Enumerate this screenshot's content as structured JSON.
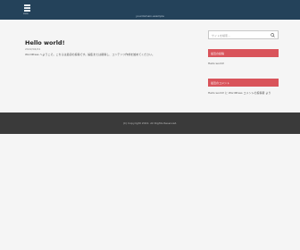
{
  "header": {
    "menu_label": "MENU",
    "site_url": "yourdomain.example"
  },
  "post": {
    "title": "Hello world!",
    "date": "2022/04/01",
    "excerpt": "WordPress へようこそ。こちらは最初の投稿です。編集または削除し、コンテンツ作成を始めてください。"
  },
  "sidebar": {
    "search_placeholder": "サイトを検索…",
    "recent_posts_heading": "最近の投稿",
    "recent_posts": [
      "Hello world!"
    ],
    "recent_comments_heading": "最近のコメント",
    "recent_comments": [
      "Hello world! に WordPress コメントの投稿者 より"
    ]
  },
  "footer": {
    "copyright": "(C) Copyright 2022. All Rights Reserved."
  }
}
